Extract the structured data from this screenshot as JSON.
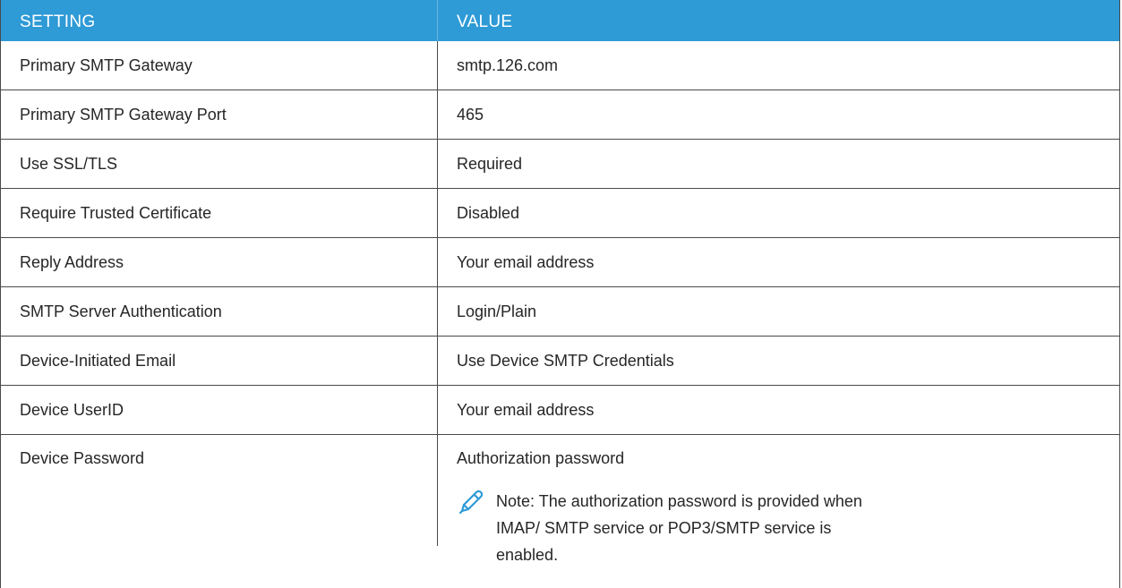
{
  "table": {
    "header": {
      "setting": "SETTING",
      "value": "VALUE"
    },
    "rows": [
      {
        "setting": "Primary SMTP Gateway",
        "value": "smtp.126.com"
      },
      {
        "setting": "Primary SMTP Gateway Port",
        "value": "465"
      },
      {
        "setting": "Use SSL/TLS",
        "value": "Required"
      },
      {
        "setting": "Require Trusted Certificate",
        "value": "Disabled"
      },
      {
        "setting": "Reply Address",
        "value": "Your email address"
      },
      {
        "setting": "SMTP Server Authentication",
        "value": "Login/Plain"
      },
      {
        "setting": "Device-Initiated Email",
        "value": "Use Device SMTP Credentials"
      },
      {
        "setting": "Device UserID",
        "value": "Your email address"
      },
      {
        "setting": "Device Password",
        "value": "Authorization password"
      }
    ],
    "note": {
      "icon": "pencil-icon",
      "text": "Note: The authorization password is provided when IMAP/ SMTP service or POP3/SMTP service is enabled."
    }
  },
  "colors": {
    "header_background": "#2e9ad6",
    "header_text": "#ffffff",
    "border": "#4a4a4a",
    "icon": "#2e9ad6"
  }
}
